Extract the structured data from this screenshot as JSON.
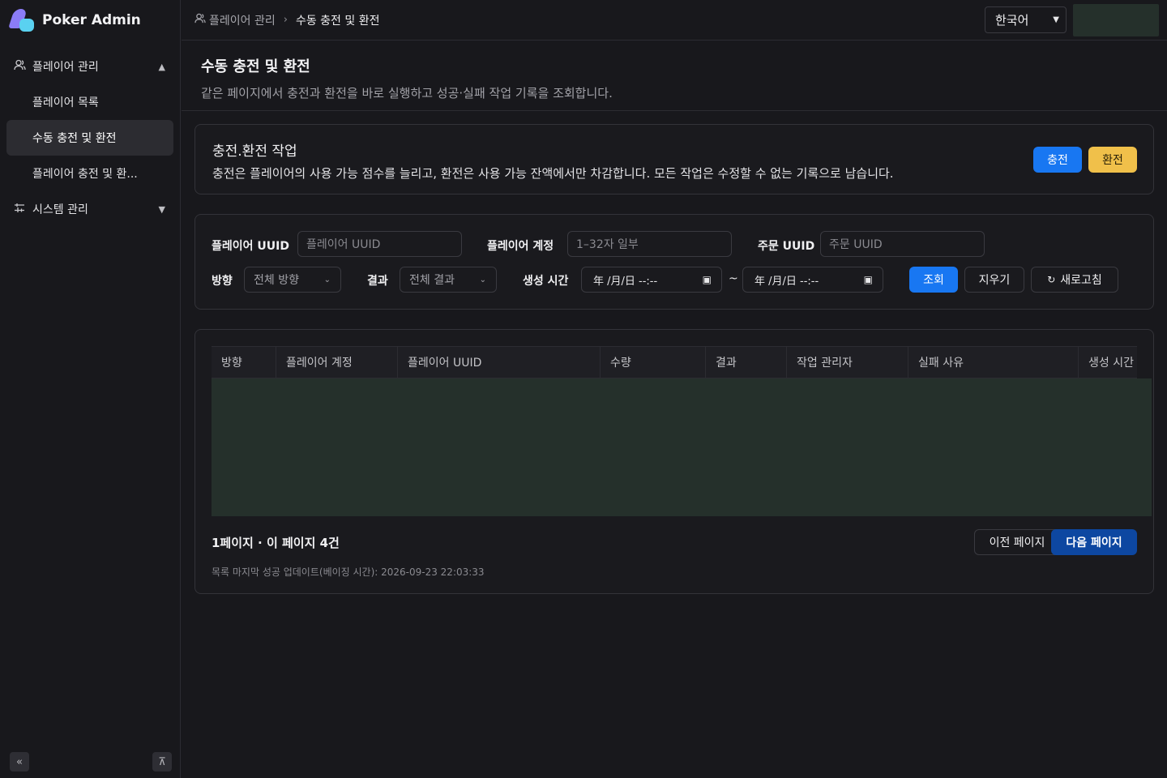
{
  "app": {
    "name": "Poker Admin"
  },
  "sidebar": {
    "items": [
      {
        "label": "플레이어 관리",
        "icon": "users-icon",
        "expanded": true,
        "children": [
          {
            "label": "플레이어 목록"
          },
          {
            "label": "수동 충전 및 환전",
            "active": true
          },
          {
            "label": "플레이어 충전 및 환..."
          }
        ]
      },
      {
        "label": "시스템 관리",
        "icon": "sliders-icon",
        "expanded": false
      }
    ],
    "collapse_icon": "«",
    "pin_icon": "⊼"
  },
  "topbar": {
    "breadcrumb": [
      {
        "label": "플레이어 관리"
      },
      {
        "label": "수동 충전 및 환전"
      }
    ],
    "language": "한국어"
  },
  "page": {
    "title": "수동 충전 및 환전",
    "description": "같은 페이지에서 충전과 환전을 바로 실행하고 성공·실패 작업 기록을 조회합니다."
  },
  "operation": {
    "title": "충전.환전 작업",
    "description": "충전은 플레이어의 사용 가능 점수를 늘리고, 환전은 사용 가능 잔액에서만 차감합니다. 모든 작업은 수정할 수 없는 기록으로 남습니다.",
    "charge_label": "충전",
    "withdraw_label": "환전"
  },
  "filters": {
    "player_uuid": {
      "label": "플레이어 UUID",
      "placeholder": "플레이어 UUID"
    },
    "player_account": {
      "label": "플레이어 계정",
      "placeholder": "1–32자 일부"
    },
    "order_uuid": {
      "label": "주문 UUID",
      "placeholder": "주문 UUID"
    },
    "direction": {
      "label": "방향",
      "value": "전체 방향"
    },
    "result": {
      "label": "결과",
      "value": "전체 결과"
    },
    "created_time": {
      "label": "생성 시간",
      "start": "年 /月/日  --:--",
      "end": "年 /月/日  --:--",
      "separator": "~"
    },
    "query_label": "조회",
    "clear_label": "지우기",
    "refresh_label": "새로고침"
  },
  "table": {
    "columns": [
      "방향",
      "플레이어 계정",
      "플레이어 UUID",
      "수량",
      "결과",
      "작업 관리자",
      "실패 사유",
      "생성 시간"
    ],
    "rows": []
  },
  "pagination": {
    "info": "1페이지 · 이 페이지 4건",
    "updated": "목록 마지막 성공 업데이트(베이징 시간): 2026-09-23 22:03:33",
    "prev_label": "이전 페이지",
    "next_label": "다음 페이지"
  },
  "colors": {
    "primary": "#1877f2",
    "warning": "#f0c04a",
    "next_button": "#0d47a1",
    "empty_table": "#25302b"
  }
}
